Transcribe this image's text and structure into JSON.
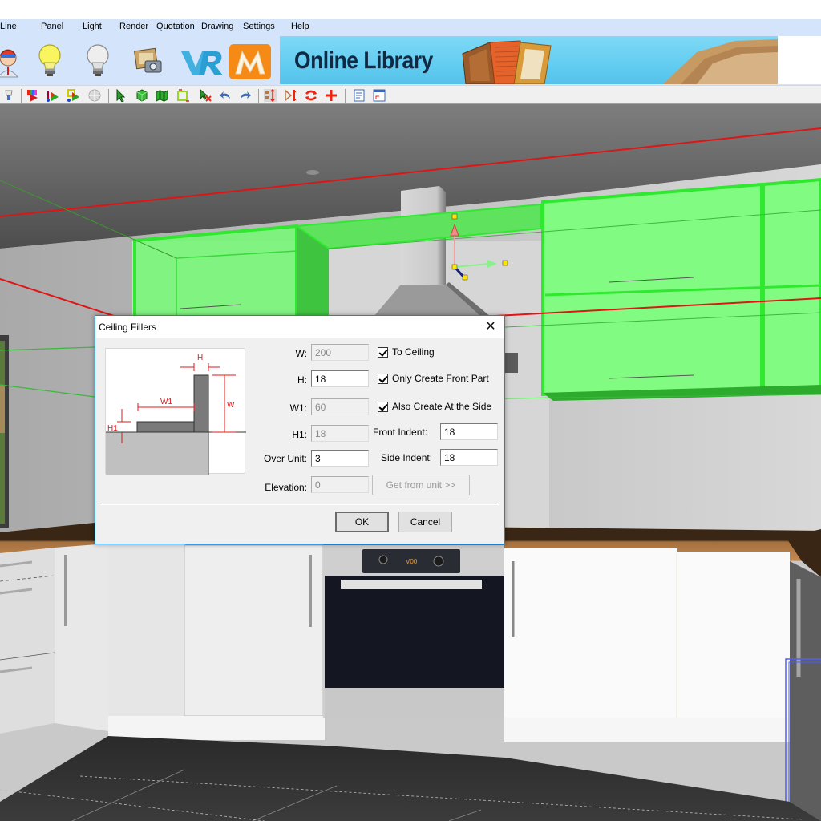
{
  "menubar": {
    "items": [
      {
        "label": "Line",
        "accel": "L"
      },
      {
        "label": "Panel",
        "accel": "P"
      },
      {
        "label": "Light",
        "accel": "L"
      },
      {
        "label": "Render",
        "accel": "R"
      },
      {
        "label": "Quotation",
        "accel": "Q"
      },
      {
        "label": "Drawing",
        "accel": "D"
      },
      {
        "label": "Settings",
        "accel": "S"
      },
      {
        "label": "Help",
        "accel": "H"
      }
    ]
  },
  "big_toolbar": {
    "icons": [
      "user-avatar-icon",
      "light-bulb-on-icon",
      "light-bulb-off-icon",
      "photo-render-icon",
      "vr-icon",
      "m-logo-icon"
    ],
    "banner_text": "Online Library"
  },
  "small_toolbar": {
    "icons": [
      "lamp-icon",
      "color-flag-icon",
      "path-flag-icon",
      "grid-flag-icon",
      "sphere-icon",
      "select-arrow-icon",
      "cube-icon",
      "wall-icon",
      "resize-box-icon",
      "delete-arrow-icon",
      "undo-icon",
      "redo-icon",
      "align-icon",
      "mirror-icon",
      "rotate-icon",
      "move-icon",
      "notes-icon",
      "layout-icon"
    ]
  },
  "dialog": {
    "title": "Ceiling Fillers",
    "close_label": "✕",
    "diagram_labels": {
      "h": "H",
      "w": "W",
      "w1": "W1",
      "h1": "H1"
    },
    "fields": {
      "w": {
        "label": "W:",
        "value": "200",
        "enabled": false
      },
      "h": {
        "label": "H:",
        "value": "18",
        "enabled": true
      },
      "w1": {
        "label": "W1:",
        "value": "60",
        "enabled": false
      },
      "h1": {
        "label": "H1:",
        "value": "18",
        "enabled": false
      },
      "over_unit": {
        "label": "Over Unit:",
        "value": "3",
        "enabled": true
      },
      "elevation": {
        "label": "Elevation:",
        "value": "0",
        "enabled": false
      },
      "front_indent": {
        "label": "Front Indent:",
        "value": "18",
        "enabled": true
      },
      "side_indent": {
        "label": "Side Indent:",
        "value": "18",
        "enabled": true
      }
    },
    "checkboxes": {
      "to_ceiling": {
        "label": "To Ceiling",
        "checked": true
      },
      "only_front": {
        "label": "Only Create Front Part",
        "checked": true
      },
      "also_side": {
        "label": "Also Create At the Side",
        "checked": true
      }
    },
    "get_from_unit_label": "Get from unit >>",
    "ok_label": "OK",
    "cancel_label": "Cancel"
  },
  "scene": {
    "description": "3D kitchen view with selected green wall cabinets, range hood, oven",
    "selection_color": "#3ef23e",
    "oven_display": "V00"
  }
}
